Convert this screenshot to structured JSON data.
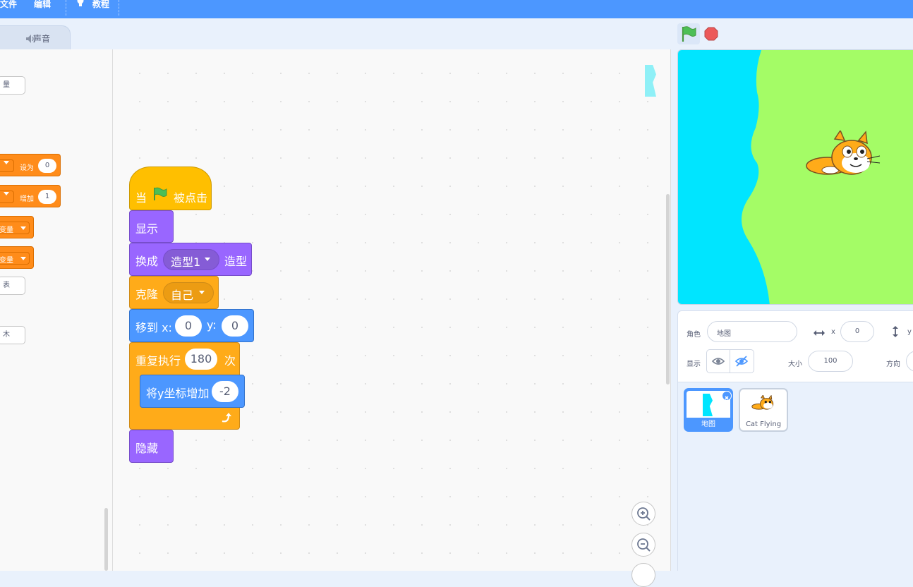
{
  "menu": {
    "file": "文件",
    "edit": "编辑",
    "tutorials": "教程"
  },
  "tabs": {
    "sound": "声音"
  },
  "palette": {
    "btn1": "量",
    "set_label": "设为",
    "set_value": "0",
    "change_label": "增加",
    "change_value": "1",
    "show_var": "变量",
    "hide_var": "变量",
    "btn2": "表",
    "btn3": "木"
  },
  "script": {
    "hat_when": "当",
    "hat_clicked": "被点击",
    "show": "显示",
    "switch_prefix": "换成",
    "switch_costume": "造型1",
    "switch_suffix": "造型",
    "clone": "克隆",
    "clone_target": "自己",
    "goto_x": "移到 x:",
    "x_value": "0",
    "goto_y": "y:",
    "y_value": "0",
    "repeat": "重复执行",
    "repeat_count": "180",
    "repeat_suffix": "次",
    "change_y": "将y坐标增加",
    "change_y_value": "-2",
    "hide": "隐藏"
  },
  "sprite_info": {
    "sprite_label": "角色",
    "sprite_name": "地图",
    "x_label": "x",
    "x_value": "0",
    "y_label": "y",
    "show_label": "显示",
    "size_label": "大小",
    "size_value": "100",
    "direction_label": "方向"
  },
  "sprites": [
    {
      "name": "地图"
    },
    {
      "name": "Cat Flying"
    }
  ],
  "colors": {
    "menubar": "#4c97ff",
    "events": "#ffbf00",
    "looks": "#9966ff",
    "control": "#ffab19",
    "motion": "#4c97ff",
    "variables": "#ff8c1a",
    "stage_water": "#00e5ff",
    "stage_land": "#a4fc66"
  }
}
